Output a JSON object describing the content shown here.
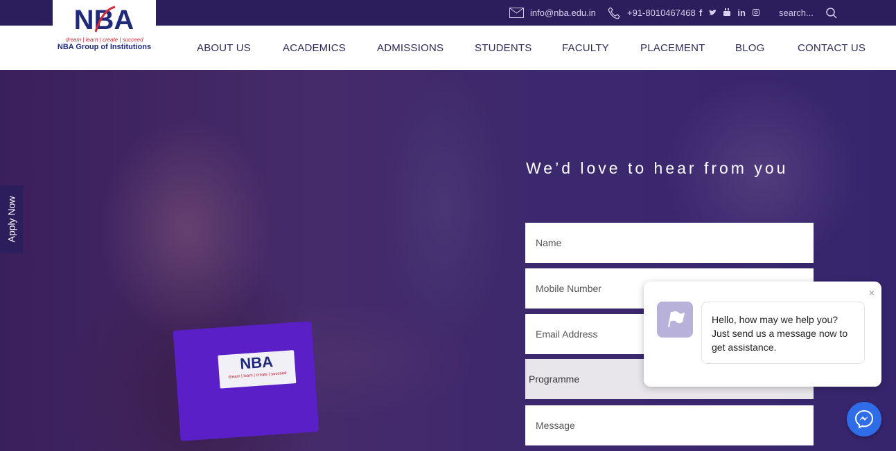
{
  "topbar": {
    "email": "info@nba.edu.in",
    "phone": "+91-8010467468",
    "social": [
      "f",
      "t",
      "yt",
      "in",
      "ig"
    ],
    "search_placeholder": "search..."
  },
  "logo": {
    "mark": "NBA",
    "tagline": "dream | learn | create | succeed",
    "name": "NBA Group of Institutions"
  },
  "nav": {
    "items": [
      "ABOUT US",
      "ACADEMICS",
      "ADMISSIONS",
      "STUDENTS",
      "FACULTY",
      "PLACEMENT",
      "BLOG",
      "CONTACT US"
    ]
  },
  "apply_tab": "Apply Now",
  "form": {
    "title": "We’d love to hear from you",
    "name_placeholder": "Name",
    "mobile_placeholder": "Mobile Number",
    "email_placeholder": "Email Address",
    "programme_label": "Programme",
    "message_placeholder": "Message"
  },
  "chat": {
    "message": "Hello, how may we help you? Just send us a message now to get assistance.",
    "close": "×"
  },
  "mic_logo": {
    "mark": "NBA",
    "tagline": "dream | learn | create | succeed"
  },
  "colors": {
    "topbar": "#2c1d5c",
    "nav_text": "#2c2c54",
    "messenger": "#2f6de8"
  }
}
